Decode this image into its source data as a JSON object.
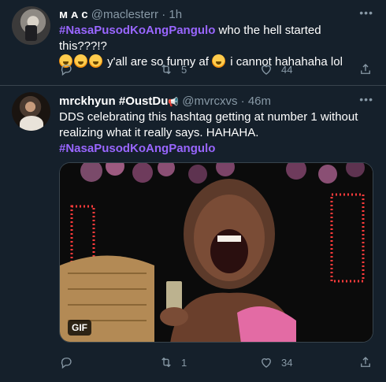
{
  "tweets": [
    {
      "display_name": "ᴍ ᴀ ᴄ",
      "handle": "@maclesterr",
      "separator": "·",
      "time": "1h",
      "hashtag": "#NasaPusodKoAngPangulo",
      "text_after_hashtag": " who the hell started this???!?",
      "line2_text": "y'all are so funny af",
      "line2_text_b": " i cannot hahahaha lol",
      "emojis_line2_prefix": [
        "loudly-crying-face",
        "loudly-crying-face",
        "loudly-crying-face"
      ],
      "emoji_mid": "laughing-face",
      "reply_count": "",
      "retweet_count": "5",
      "like_count": "44"
    },
    {
      "display_name": "mrckhyun #OustDu",
      "handle": "@mvrcxvs",
      "separator": "·",
      "time": "46m",
      "text": "DDS celebrating this hashtag getting at number 1 without realizing what it really says. HAHAHA.",
      "hashtag": "#NasaPusodKoAngPangulo",
      "media_badge": "GIF",
      "reply_count": "",
      "retweet_count": "1",
      "like_count": "34"
    }
  ],
  "colors": {
    "background": "#15202b",
    "divider": "#38444d",
    "secondary_text": "#8899a6",
    "hashtag": "#9966ff",
    "text": "#ffffff"
  },
  "icons": [
    "reply-icon",
    "retweet-icon",
    "like-icon",
    "share-icon",
    "more-icon"
  ]
}
